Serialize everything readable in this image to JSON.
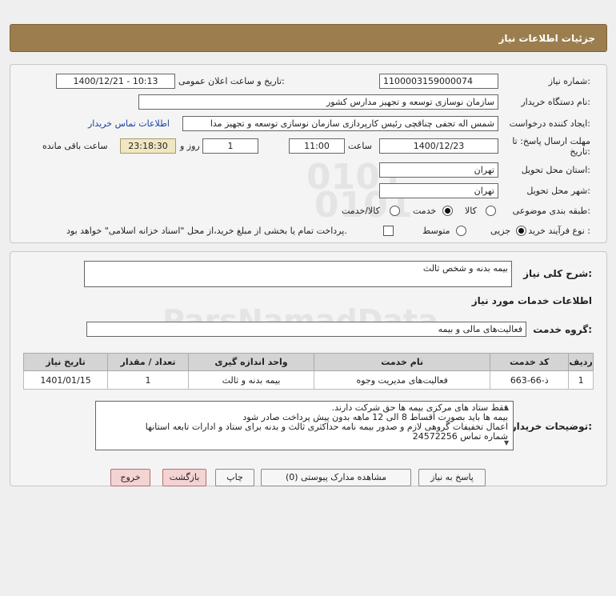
{
  "header": {
    "title": "جزئیات اطلاعات نیاز"
  },
  "fields": {
    "need_number_label": "شماره نیاز:",
    "need_number": "1100003159000074",
    "announce_label": "تاریخ و ساعت اعلان عمومی:",
    "announce_value": "1400/12/21 - 10:13",
    "buyer_org_label": "نام دستگاه خریدار:",
    "buyer_org": "سازمان نوسازی  توسعه و تجهیز مدارس کشور",
    "requester_label": "ایجاد کننده درخواست:",
    "requester": "شمس اله تجفی چناقچی رئیس کارپردازی سازمان نوسازی  توسعه و تجهیز مدا",
    "contact_link": "اطلاعات تماس خریدار",
    "deadline_label_1": "مهلت ارسال پاسخ: تا",
    "deadline_label_2": "تاریخ:",
    "deadline_date": "1400/12/23",
    "time_label": "ساعت",
    "deadline_time": "11:00",
    "days_value": "1",
    "days_label": "روز و",
    "remaining_time": "23:18:30",
    "remaining_label": "ساعت باقی مانده",
    "province_label": "استان محل تحویل:",
    "province": "تهران",
    "city_label": "شهر محل تحویل:",
    "city": "تهران",
    "category_label": "طبقه بندی موضوعی:",
    "category_options": [
      "کالا",
      "خدمت",
      "کالا/خدمت"
    ],
    "category_selected": "خدمت",
    "process_label": "نوع فرآیند خرید :",
    "process_options": [
      "جزیی",
      "متوسط"
    ],
    "process_selected": "جزیی",
    "treasury_note": "پرداخت تمام یا بخشی از مبلغ خرید،از محل \"اسناد خزانه اسلامی\" خواهد بود."
  },
  "summary": {
    "title_label": "شرح کلی نیاز:",
    "title_value": "بیمه بدنه و شخص ثالث",
    "services_heading": "اطلاعات خدمات مورد نیاز",
    "service_group_label": "گروه خدمت:",
    "service_group": "فعالیت‌های مالی و بیمه"
  },
  "table": {
    "headers": [
      "ردیف",
      "کد خدمت",
      "نام خدمت",
      "واحد اندازه گیری",
      "تعداد / مقدار",
      "تاریخ نیاز"
    ],
    "rows": [
      [
        "1",
        "ذ-66-663",
        "فعالیت‌های مدیریت وجوه",
        "بیمه بدنه و ثالث",
        "1",
        "1401/01/15"
      ]
    ]
  },
  "buyer_notes": {
    "label": "توضیحات خریدار:",
    "lines": [
      "فقط ستاد های مرکزی بیمه ها حق شرکت دارند.",
      "بیمه ها باید بصورت اقساط 8 الی 12 ماهه بدون پیش پرداخت صادر شود",
      "اعمال تخفیفات گروهی لازم و صدور بیمه نامه حداکثری ثالث و بدنه برای ستاد و ادارات تابعه استانها",
      "شماره تماس 24572256"
    ]
  },
  "buttons": {
    "reply": "پاسخ به نیاز",
    "view_docs": "مشاهده مدارک پیوستی (0)",
    "print": "چاپ",
    "back": "بازگشت",
    "exit": "خروج"
  },
  "watermark": {
    "numbers": "0101",
    "numbers2": "0101",
    "brand": "ParsNamadData"
  }
}
